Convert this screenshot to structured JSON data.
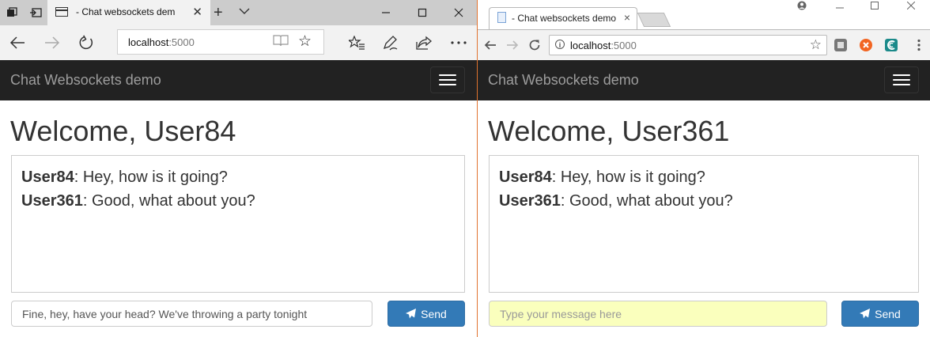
{
  "edge": {
    "tab_title": "- Chat websockets dem",
    "close_glyph": "✕",
    "address_host": "localhost",
    "address_port": ":5000",
    "page": {
      "brand": "Chat Websockets demo",
      "welcome": "Welcome, User84",
      "messages": [
        {
          "user": "User84",
          "text": ": Hey, how is it going?"
        },
        {
          "user": "User361",
          "text": ": Good, what about you?"
        }
      ],
      "input_value": "Fine, hey, have your head? We've throwing a party tonight",
      "input_placeholder": "Type your message here",
      "send_label": "Send"
    }
  },
  "chrome": {
    "tab_title": "- Chat websockets demo",
    "close_glyph": "×",
    "address_host": "localhost",
    "address_port": ":5000",
    "page": {
      "brand": "Chat Websockets demo",
      "welcome": "Welcome, User361",
      "messages": [
        {
          "user": "User84",
          "text": ": Hey, how is it going?"
        },
        {
          "user": "User361",
          "text": ": Good, what about you?"
        }
      ],
      "input_value": "",
      "input_placeholder": "Type your message here",
      "send_label": "Send"
    }
  },
  "colors": {
    "navbar_bg": "#222222",
    "brand_text": "#9d9d9d",
    "send_button": "#337ab7",
    "autofill_input_bg": "#faffbd",
    "window_divider": "#e0732f"
  },
  "icons": {
    "edge": [
      "tab-list-icon",
      "set-aside-tabs-icon",
      "page-icon",
      "close-icon",
      "new-tab-icon",
      "tab-preview-icon",
      "minimize-icon",
      "maximize-icon",
      "close-window-icon",
      "back-icon",
      "forward-icon",
      "refresh-icon",
      "reading-view-icon",
      "favorite-star-icon",
      "favorites-hub-icon",
      "web-note-icon",
      "share-icon",
      "more-icon"
    ],
    "chrome": [
      "document-icon",
      "close-icon",
      "profile-icon",
      "minimize-icon",
      "maximize-icon",
      "close-window-icon",
      "back-icon",
      "forward-icon",
      "reload-icon",
      "info-icon",
      "bookmark-star-icon",
      "extension-icon",
      "menu-icon"
    ],
    "page": [
      "hamburger-menu-icon",
      "send-icon"
    ]
  }
}
